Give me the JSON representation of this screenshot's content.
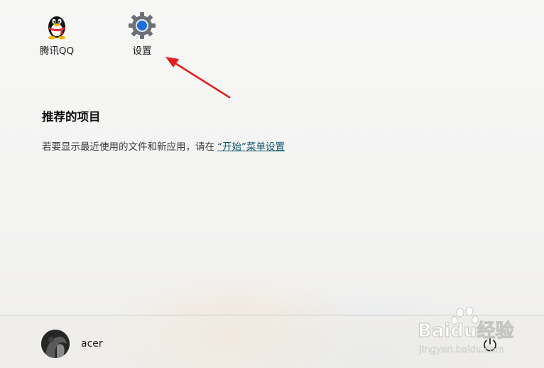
{
  "pinned_apps": [
    {
      "label": "腾讯QQ",
      "icon": "qq-penguin-icon"
    },
    {
      "label": "设置",
      "icon": "gear-icon"
    }
  ],
  "recommended": {
    "title": "推荐的项目",
    "description": "若要显示最近使用的文件和新应用，请在",
    "link_text": "“开始”菜单设置"
  },
  "footer": {
    "user_name": "acer",
    "power_icon": "power-icon"
  },
  "watermark": {
    "brand_text": "Baidu经验",
    "url_text": "jingyan.baidu.com"
  },
  "colors": {
    "arrow": "#e02020",
    "link": "#0b5566",
    "gear_blue": "#1e6fd9"
  }
}
